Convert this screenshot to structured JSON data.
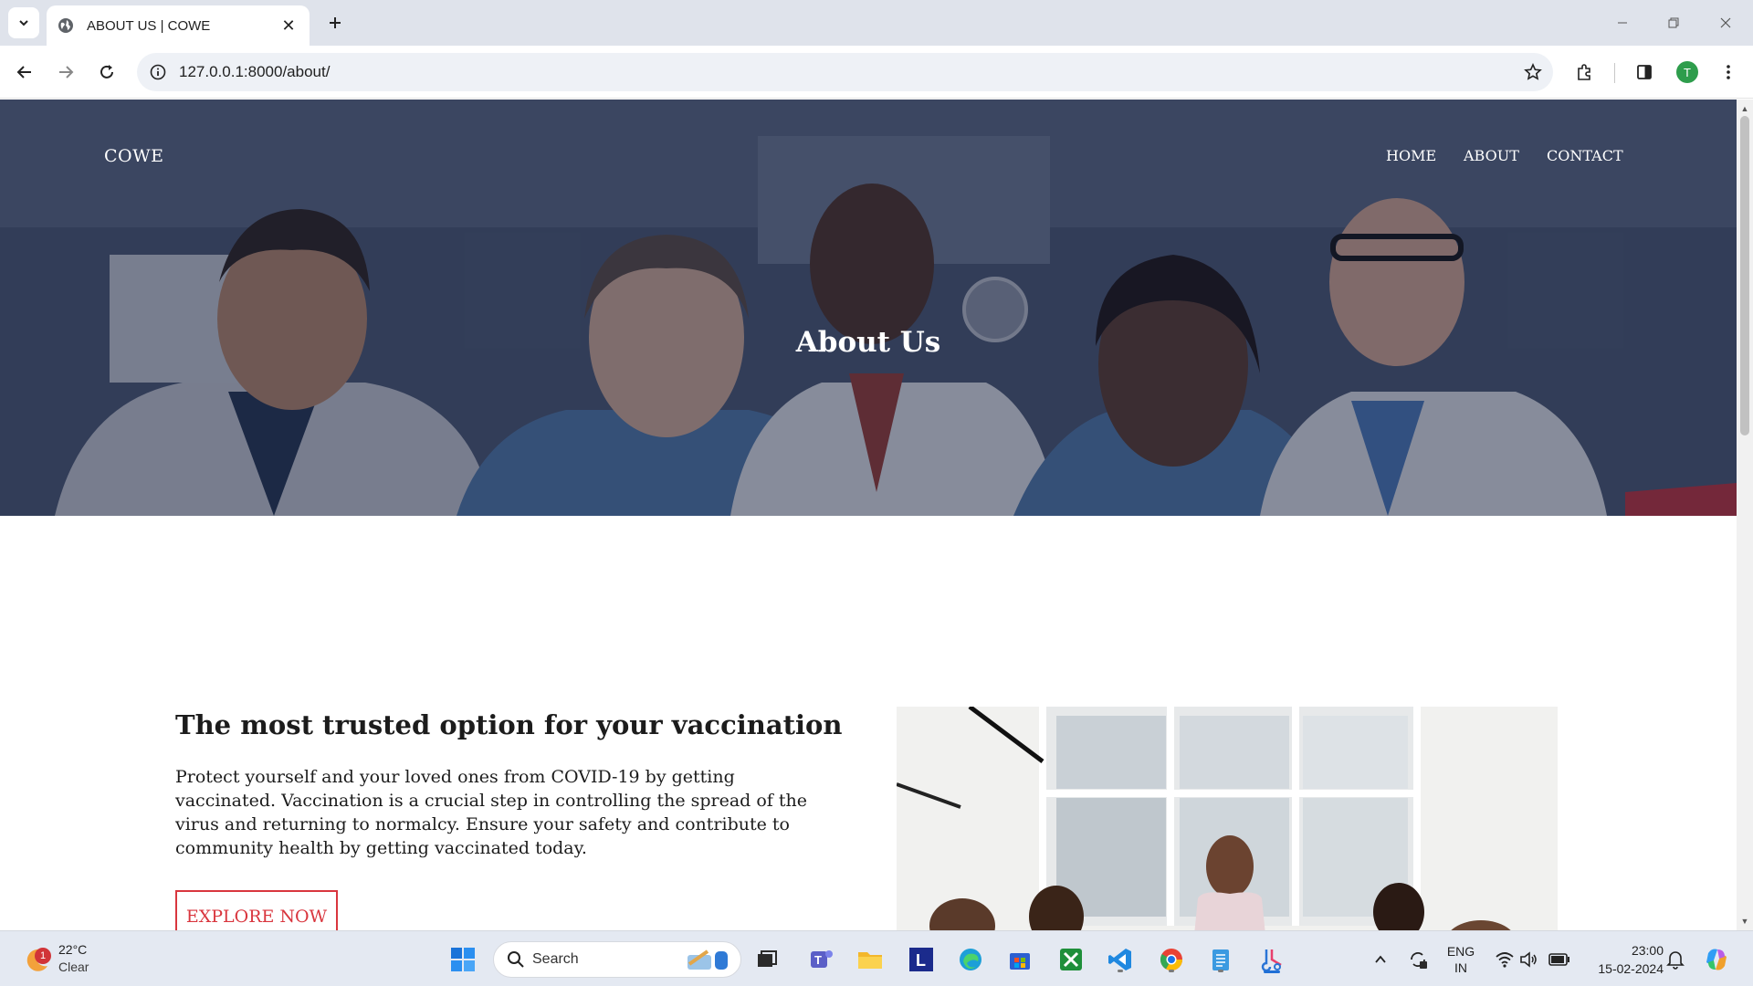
{
  "browser": {
    "tab": {
      "title": "ABOUT US | COWE",
      "favicon": "globe-icon"
    },
    "url": "127.0.0.1:8000/about/",
    "profile_initial": "T"
  },
  "site": {
    "brand": "COWE",
    "nav": [
      "HOME",
      "ABOUT",
      "CONTACT"
    ],
    "hero_title": "About Us",
    "about": {
      "heading": "The most trusted option for your vaccination",
      "body": "Protect yourself and your loved ones from COVID-19 by getting vaccinated. Vaccination is a crucial step in controlling the spread of the virus and returning to normalcy. Ensure your safety and contribute to community health by getting vaccinated today.",
      "cta": "EXPLORE NOW"
    },
    "colors": {
      "accent": "#d9363e",
      "hero_overlay": "#16203c"
    }
  },
  "taskbar": {
    "weather": {
      "temp": "22°C",
      "condition": "Clear",
      "badge": "1"
    },
    "search_placeholder": "Search",
    "language": {
      "line1": "ENG",
      "line2": "IN"
    },
    "time": "23:00",
    "date": "15-02-2024"
  }
}
